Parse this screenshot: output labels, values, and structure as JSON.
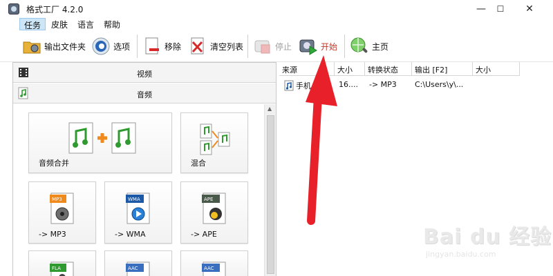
{
  "window": {
    "title": "格式工厂 4.2.0",
    "minimize": "—",
    "maximize": "☐",
    "close": "✕"
  },
  "menu": [
    {
      "label": "任务",
      "active": true
    },
    {
      "label": "皮肤"
    },
    {
      "label": "语言"
    },
    {
      "label": "帮助"
    }
  ],
  "toolbar": {
    "output_folder": "输出文件夹",
    "options": "选项",
    "remove": "移除",
    "clear_list": "清空列表",
    "stop": "停止",
    "start": "开始",
    "home": "主页"
  },
  "categories": {
    "video": "视频",
    "audio": "音频"
  },
  "tiles": {
    "audio_merge": "音频合并",
    "mix": "混合",
    "mp3": "-> MP3",
    "wma": "-> WMA",
    "ape": "-> APE",
    "badge_mp3": "MP3",
    "badge_wma": "WMA",
    "badge_ape": "APE",
    "badge_fla": "FLA",
    "badge_aac1": "AAC",
    "badge_aac2": "AAC"
  },
  "task_list": {
    "columns": [
      "来源",
      "大小",
      "转换状态",
      "输出 [F2]",
      "大小"
    ],
    "rows": [
      {
        "source": "手机",
        "size": "16....",
        "status": "-> MP3",
        "output": "C:\\Users\\y\\...",
        "out_size": ""
      }
    ]
  },
  "watermark": {
    "main": "Bai du 经验",
    "sub": "jingyan.baidu.com"
  },
  "colors": {
    "start_text": "#c0392b",
    "stop_text": "#a0a0a0",
    "arrow": "#e8202a"
  }
}
